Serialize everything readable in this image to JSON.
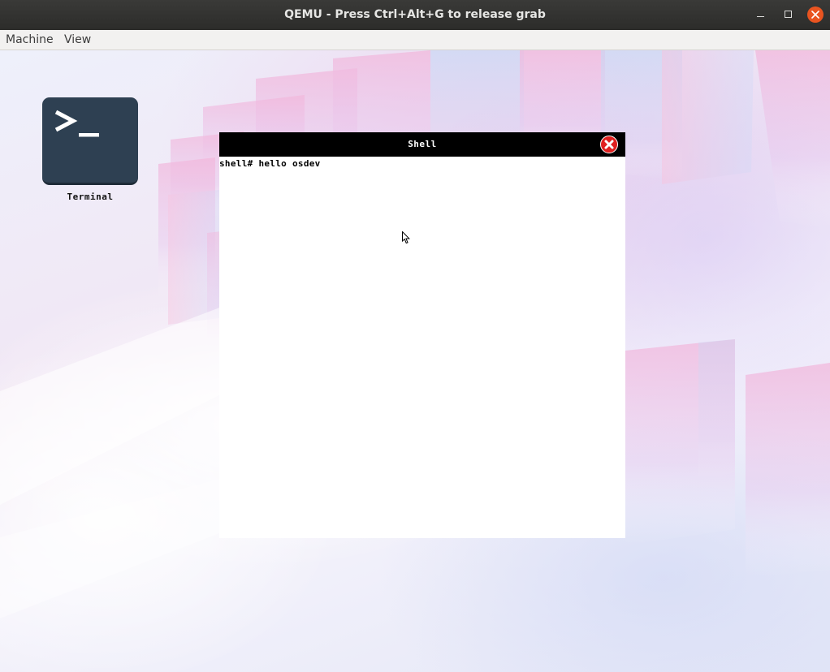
{
  "window": {
    "title": "QEMU - Press Ctrl+Alt+G to release grab",
    "controls": [
      "minimize-icon",
      "maximize-icon",
      "close-icon"
    ],
    "close_color": "#e95420"
  },
  "menubar": {
    "items": [
      {
        "label": "Machine"
      },
      {
        "label": "View"
      }
    ]
  },
  "desktop": {
    "icons": [
      {
        "label": "Terminal",
        "icon": "terminal-icon",
        "tile_color": "#2e4052"
      }
    ]
  },
  "shell_window": {
    "title": "Shell",
    "close_icon": "close-icon",
    "close_color": "#e02020",
    "lines": [
      "shell# hello osdev"
    ]
  }
}
